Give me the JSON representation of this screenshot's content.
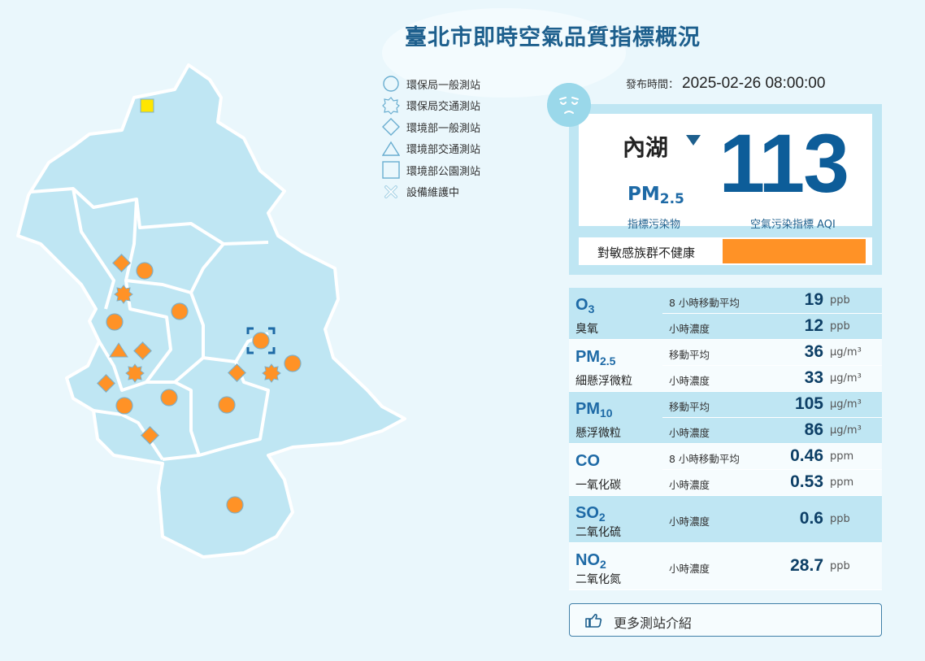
{
  "title": "臺北市即時空氣品質指標概況",
  "legend": [
    {
      "icon": "circle-icon",
      "label": "環保局一般測站"
    },
    {
      "icon": "sun-badge-icon",
      "label": "環保局交通測站"
    },
    {
      "icon": "diamond-icon",
      "label": "環境部一般測站"
    },
    {
      "icon": "triangle-icon",
      "label": "環境部交通測站"
    },
    {
      "icon": "square-icon",
      "label": "環境部公園測站"
    },
    {
      "icon": "cross-icon",
      "label": "設備維護中"
    }
  ],
  "publish": {
    "label": "發布時間：",
    "time": "2025-02-26 08:00:00"
  },
  "face_icon": "sad-face-icon",
  "main": {
    "station": "內湖",
    "pollutant_symbol": "PM",
    "pollutant_sub": "2.5",
    "aqi": "113",
    "label_pollutant": "指標污染物",
    "label_aqi": "空氣污染指標 AQI",
    "status": "對敏感族群不健康",
    "status_color": "#ff9226"
  },
  "pollutants": [
    {
      "symbol": "O",
      "sub": "3",
      "name": "臭氧",
      "readings": [
        {
          "label": "8 小時移動平均",
          "value": "19",
          "unit": "ppb"
        },
        {
          "label": "小時濃度",
          "value": "12",
          "unit": "ppb"
        }
      ]
    },
    {
      "symbol": "PM",
      "sub": "2.5",
      "name": "細懸浮微粒",
      "readings": [
        {
          "label": "移動平均",
          "value": "36",
          "unit": "μg/m³"
        },
        {
          "label": "小時濃度",
          "value": "33",
          "unit": "μg/m³"
        }
      ]
    },
    {
      "symbol": "PM",
      "sub": "10",
      "name": "懸浮微粒",
      "readings": [
        {
          "label": "移動平均",
          "value": "105",
          "unit": "μg/m³"
        },
        {
          "label": "小時濃度",
          "value": "86",
          "unit": "μg/m³"
        }
      ]
    },
    {
      "symbol": "CO",
      "sub": "",
      "name": "一氧化碳",
      "readings": [
        {
          "label": "8 小時移動平均",
          "value": "0.46",
          "unit": "ppm"
        },
        {
          "label": "小時濃度",
          "value": "0.53",
          "unit": "ppm"
        }
      ]
    },
    {
      "symbol": "SO",
      "sub": "2",
      "name": "二氧化硫",
      "readings": [
        {
          "label": "小時濃度",
          "value": "0.6",
          "unit": "ppb"
        }
      ]
    },
    {
      "symbol": "NO",
      "sub": "2",
      "name": "二氧化氮",
      "readings": [
        {
          "label": "小時濃度",
          "value": "28.7",
          "unit": "ppb"
        }
      ]
    }
  ],
  "more_button": {
    "icon": "pointing-hand-icon",
    "label": "更多測站介紹"
  },
  "map": {
    "region_fill": "#bfe6f3",
    "marker_color": "#ff9226",
    "park_station_color": "#ffe600",
    "stations": [
      {
        "shape": "square",
        "aqi_color": "#ffe600"
      },
      {
        "shape": "diamond",
        "aqi_color": "#ff9226"
      },
      {
        "shape": "circle",
        "aqi_color": "#ff9226"
      },
      {
        "shape": "sun",
        "aqi_color": "#ff9226"
      },
      {
        "shape": "circle",
        "aqi_color": "#ff9226"
      },
      {
        "shape": "circle",
        "aqi_color": "#ff9226"
      },
      {
        "shape": "triangle",
        "aqi_color": "#ff9226"
      },
      {
        "shape": "diamond",
        "aqi_color": "#ff9226"
      },
      {
        "shape": "sun",
        "aqi_color": "#ff9226"
      },
      {
        "shape": "diamond",
        "aqi_color": "#ff9226"
      },
      {
        "shape": "circle",
        "aqi_color": "#ff9226"
      },
      {
        "shape": "circle",
        "aqi_color": "#ff9226"
      },
      {
        "shape": "diamond",
        "aqi_color": "#ff9226"
      },
      {
        "shape": "circle",
        "aqi_color": "#ff9226"
      },
      {
        "shape": "diamond",
        "aqi_color": "#ff9226"
      },
      {
        "shape": "circle",
        "aqi_color": "#ff9226",
        "selected": true
      },
      {
        "shape": "sun",
        "aqi_color": "#ff9226"
      },
      {
        "shape": "circle",
        "aqi_color": "#ff9226"
      },
      {
        "shape": "circle",
        "aqi_color": "#ff9226"
      }
    ]
  }
}
